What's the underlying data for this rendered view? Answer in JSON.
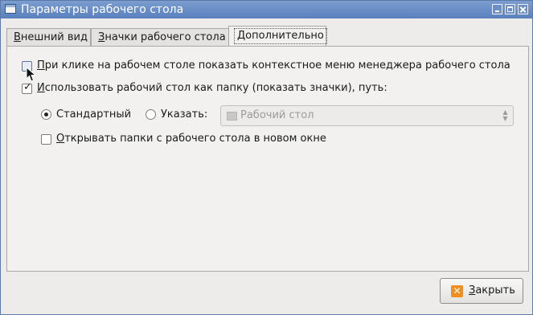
{
  "window": {
    "title": "Параметры рабочего стола",
    "buttons": [
      "minimize",
      "maximize",
      "close"
    ]
  },
  "tabs": [
    {
      "label_accel": "В",
      "label_rest": "нешний вид",
      "active": false
    },
    {
      "label_accel": "З",
      "label_rest": "начки рабочего стола",
      "active": false
    },
    {
      "label_accel": "Д",
      "label_rest": "ополнительно",
      "active": true
    }
  ],
  "options": {
    "context_menu": {
      "accel": "П",
      "label_rest": "ри клике на рабочем столе показать контекстное меню менеджера рабочего стола",
      "checked": false
    },
    "use_as_folder": {
      "accel": "И",
      "label_rest": "спользовать рабочий стол как папку (показать значки), путь:",
      "checked": true
    },
    "path_mode": {
      "standard_label": "Стандартный",
      "custom_label": "Указать:",
      "selected": "standard"
    },
    "path_combo": {
      "value": "Рабочий стол",
      "enabled": false
    },
    "open_new_window": {
      "accel": "О",
      "label_rest": "ткрывать папки с рабочего стола в новом окне",
      "checked": false
    }
  },
  "footer": {
    "close_accel": "З",
    "close_rest": "акрыть",
    "close_icon": "close-icon"
  },
  "icons": {
    "check": "✓",
    "close": "✕",
    "arrow_up": "▲",
    "arrow_down": "▼"
  },
  "colors": {
    "titlebar": "#6a8fc8",
    "accent_icon": "#ef8f1f"
  }
}
